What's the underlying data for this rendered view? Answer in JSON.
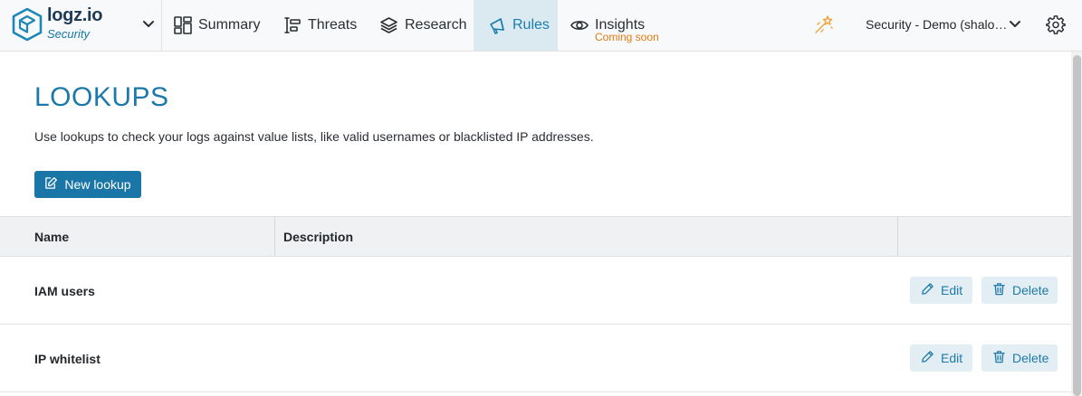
{
  "brand": {
    "name": "logz.io",
    "product": "Security"
  },
  "nav": {
    "items": [
      {
        "label": "Summary",
        "icon": "dashboard-icon"
      },
      {
        "label": "Threats",
        "icon": "threats-icon"
      },
      {
        "label": "Research",
        "icon": "layers-icon"
      },
      {
        "label": "Rules",
        "icon": "megaphone-icon",
        "active": true
      },
      {
        "label": "Insights",
        "icon": "eye-icon",
        "note": "Coming soon"
      }
    ]
  },
  "header": {
    "account": "Security - Demo (shalo…",
    "icons": [
      "magic-wand-icon",
      "chevron-down-icon",
      "gear-icon"
    ]
  },
  "page": {
    "title": "LOOKUPS",
    "description": "Use lookups to check your logs against value lists, like valid usernames or blacklisted IP addresses.",
    "new_button": "New lookup"
  },
  "table": {
    "columns": [
      "Name",
      "Description",
      ""
    ],
    "rows": [
      {
        "name": "IAM users",
        "description": ""
      },
      {
        "name": "IP whitelist",
        "description": ""
      }
    ],
    "edit_label": "Edit",
    "delete_label": "Delete"
  },
  "colors": {
    "accent": "#1a76a6",
    "active_tab_bg": "#dbe9f1",
    "coming_soon": "#e07b0f",
    "action_button_bg": "#e3eef4"
  }
}
